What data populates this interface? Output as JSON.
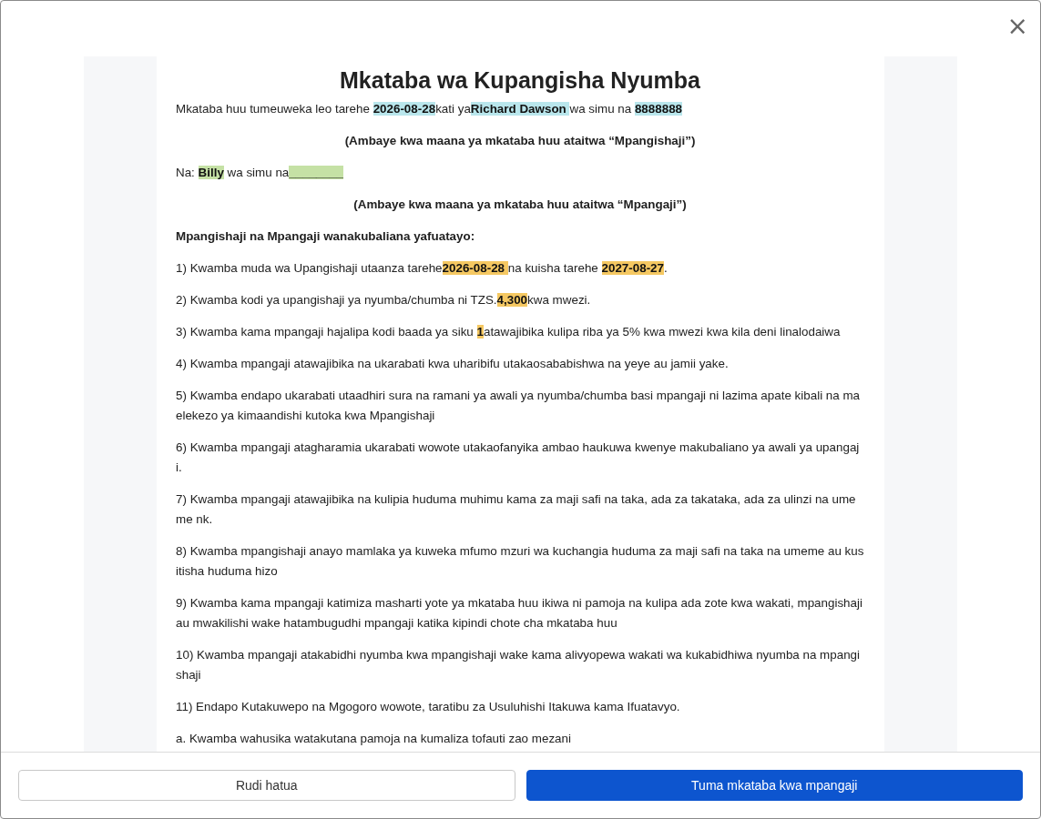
{
  "dialog": {
    "close": "×"
  },
  "document": {
    "title": "Mkataba wa Kupangisha Nyumba",
    "paragraphs": [
      {
        "kind": "text",
        "segments": [
          {
            "text": "Mkataba huu tumeuweka leo tarehe "
          },
          {
            "text": "2026-08-28",
            "color": "#b9e6ec"
          },
          {
            "text": "kati ya"
          },
          {
            "text": "Richard Dawson ",
            "color": "#b9e6ec"
          },
          {
            "text": " wa simu na "
          },
          {
            "text": "8888888",
            "color": "#b9e6ec"
          }
        ]
      },
      {
        "kind": "center",
        "segments": [
          {
            "text": "(Ambaye kwa maana ya mkataba huu ataitwa “Mpangishaji”)"
          }
        ]
      },
      {
        "kind": "text",
        "segments": [
          {
            "text": "Na: "
          },
          {
            "text": "Billy",
            "color": "#c5e1a5"
          },
          {
            "text": " wa simu na"
          },
          {
            "text": "________",
            "color": "#c5e1a5"
          }
        ]
      },
      {
        "kind": "center",
        "segments": [
          {
            "text": "(Ambaye kwa maana ya mkataba huu ataitwa “Mpangaji”)"
          }
        ]
      },
      {
        "kind": "heading",
        "segments": [
          {
            "text": "Mpangishaji na Mpangaji wanakubaliana yafuatayo:"
          }
        ]
      },
      {
        "kind": "text",
        "segments": [
          {
            "text": "1) Kwamba muda wa Upangishaji utaanza tarehe"
          },
          {
            "text": "2026-08-28 ",
            "color": "#f5c862"
          },
          {
            "text": " na kuisha tarehe "
          },
          {
            "text": "2027-08-27",
            "color": "#f5c862"
          },
          {
            "text": "."
          }
        ]
      },
      {
        "kind": "text",
        "segments": [
          {
            "text": "2) Kwamba kodi ya upangishaji ya nyumba/chumba ni TZS."
          },
          {
            "text": "4,300",
            "color": "#f5c862"
          },
          {
            "text": "kwa mwezi."
          }
        ]
      },
      {
        "kind": "text",
        "segments": [
          {
            "text": "3) Kwamba kama mpangaji hajalipa kodi baada ya siku "
          },
          {
            "text": "1",
            "color": "#f5c862"
          },
          {
            "text": "atawajibika kulipa riba ya 5% kwa mwezi kwa kila deni linalodaiwa"
          }
        ]
      },
      {
        "kind": "text",
        "segments": [
          {
            "text": "4) Kwamba mpangaji atawajibika na ukarabati kwa uharibifu utakaosababishwa na yeye au jamii yake."
          }
        ]
      },
      {
        "kind": "text",
        "segments": [
          {
            "text": "5) Kwamba endapo ukarabati utaadhiri sura na ramani ya awali ya nyumba/chumba basi mpangaji ni lazima apate kibali na maelekezo ya kimaandishi kutoka kwa Mpangishaji"
          }
        ]
      },
      {
        "kind": "text",
        "segments": [
          {
            "text": "6) Kwamba mpangaji atagharamia ukarabati wowote utakaofanyika ambao haukuwa kwenye makubaliano ya awali ya upangaji."
          }
        ]
      },
      {
        "kind": "text",
        "segments": [
          {
            "text": "7) Kwamba mpangaji atawajibika na kulipia huduma muhimu kama za maji safi na taka, ada za takataka, ada za ulinzi na umeme nk."
          }
        ]
      },
      {
        "kind": "text",
        "segments": [
          {
            "text": "8) Kwamba mpangishaji anayo mamlaka ya kuweka mfumo mzuri wa kuchangia huduma za maji safi na taka na umeme au kusitisha huduma hizo"
          }
        ]
      },
      {
        "kind": "text",
        "segments": [
          {
            "text": "9) Kwamba kama mpangaji katimiza masharti yote ya mkataba huu ikiwa ni pamoja na kulipa ada zote kwa wakati, mpangishaji au mwakilishi wake hatambugudhi mpangaji katika kipindi chote cha mkataba huu"
          }
        ]
      },
      {
        "kind": "text",
        "segments": [
          {
            "text": "10) Kwamba mpangaji atakabidhi nyumba kwa mpangishaji wake kama alivyopewa wakati wa kukabidhiwa nyumba na mpangishaji"
          }
        ]
      },
      {
        "kind": "text",
        "segments": [
          {
            "text": "11) Endapo Kutakuwepo na Mgogoro wowote, taratibu za Usuluhishi Itakuwa kama Ifuatavyo."
          }
        ]
      },
      {
        "kind": "text",
        "segments": [
          {
            "text": "a. Kwamba wahusika watakutana pamoja na kumaliza tofauti zao mezani"
          }
        ]
      }
    ]
  },
  "buttons": [
    {
      "label": "Rudi hatua",
      "kind": "secondary"
    },
    {
      "label": "Tuma mkataba kwa mpangaji",
      "kind": "primary"
    }
  ]
}
